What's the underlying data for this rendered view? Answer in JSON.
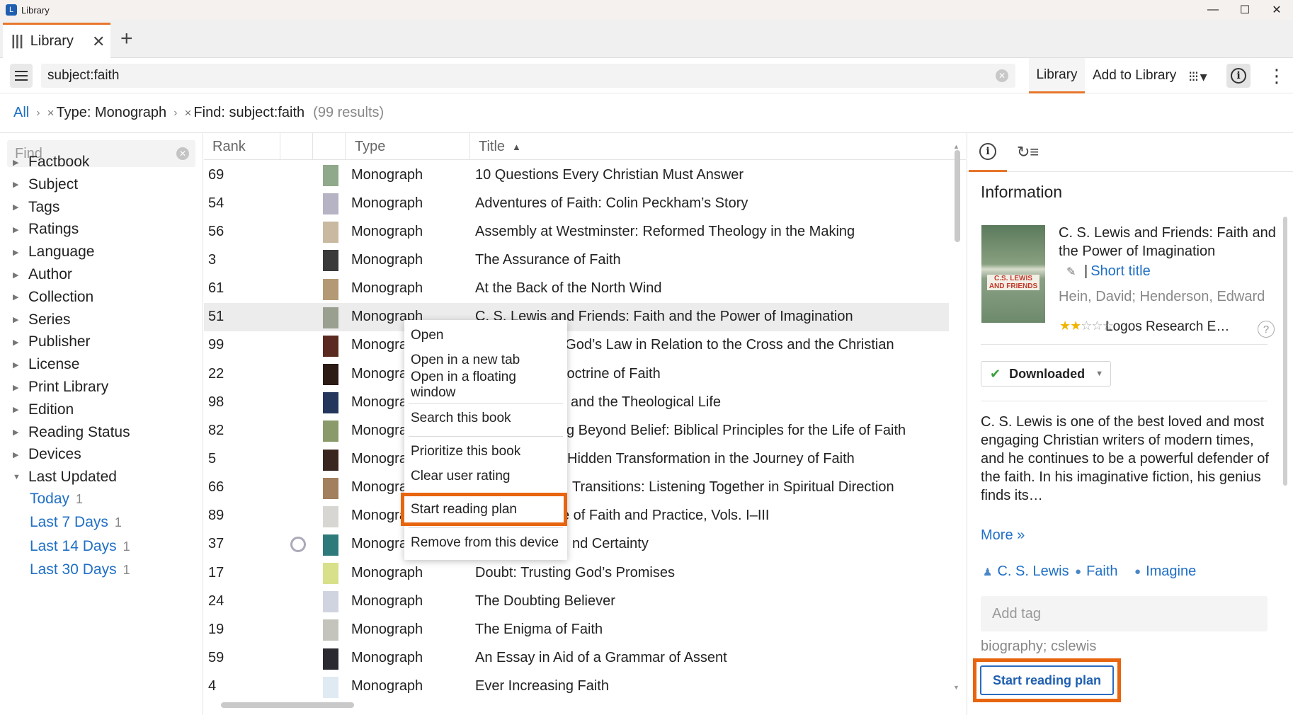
{
  "window": {
    "title": "Library"
  },
  "tabs": {
    "active_label": "Library"
  },
  "toolbar": {
    "search_value": "subject:faith",
    "tab_library": "Library",
    "tab_add": "Add to Library"
  },
  "breadcrumb": {
    "all": "All",
    "crumb1": "Type: Monograph",
    "crumb2": "Find: subject:faith",
    "count": "(99 results)"
  },
  "sidebar": {
    "find_placeholder": "Find",
    "facets": [
      "Factbook",
      "Subject",
      "Tags",
      "Ratings",
      "Language",
      "Author",
      "Collection",
      "Series",
      "Publisher",
      "License",
      "Print Library",
      "Edition",
      "Reading Status",
      "Devices",
      "Last Updated"
    ],
    "last_updated": [
      {
        "label": "Today",
        "count": "1"
      },
      {
        "label": "Last 7 Days",
        "count": "1"
      },
      {
        "label": "Last 14 Days",
        "count": "1"
      },
      {
        "label": "Last 30 Days",
        "count": "1"
      }
    ]
  },
  "table": {
    "headers": {
      "rank": "Rank",
      "type": "Type",
      "title": "Title"
    },
    "rows": [
      {
        "rank": "69",
        "type": "Monograph",
        "title": "10 Questions Every Christian Must Answer"
      },
      {
        "rank": "54",
        "type": "Monograph",
        "title": "Adventures of Faith: Colin Peckham’s Story"
      },
      {
        "rank": "56",
        "type": "Monograph",
        "title": "Assembly at Westminster: Reformed Theology in the Making"
      },
      {
        "rank": "3",
        "type": "Monograph",
        "title": "The Assurance of Faith"
      },
      {
        "rank": "61",
        "type": "Monograph",
        "title": "At the Back of the North Wind"
      },
      {
        "rank": "51",
        "type": "Monograph",
        "title": "C. S. Lewis and Friends: Faith and the Power of Imagination"
      },
      {
        "rank": "99",
        "type": "Monograph",
        "title": "d: God’s Law in Relation to the Cross and the Christian"
      },
      {
        "rank": "22",
        "type": "Monograph",
        "title": "Doctrine of Faith"
      },
      {
        "rank": "98",
        "type": "Monograph",
        "title": "and the Theological Life"
      },
      {
        "rank": "82",
        "type": "Monograph",
        "title": "g Beyond Belief: Biblical Principles for the Life of Faith"
      },
      {
        "rank": "5",
        "type": "Monograph",
        "title": "Hidden Transformation in the Journey of Faith"
      },
      {
        "rank": "66",
        "type": "Monograph",
        "title": "Transitions: Listening Together in Spiritual Direction"
      },
      {
        "rank": "89",
        "type": "Monograph",
        "title": "e of Faith and Practice, Vols. I–III"
      },
      {
        "rank": "37",
        "type": "Monograph",
        "title": "nd Certainty"
      },
      {
        "rank": "17",
        "type": "Monograph",
        "title": "Doubt: Trusting God’s Promises"
      },
      {
        "rank": "24",
        "type": "Monograph",
        "title": "The Doubting Believer"
      },
      {
        "rank": "19",
        "type": "Monograph",
        "title": "The Enigma of Faith"
      },
      {
        "rank": "59",
        "type": "Monograph",
        "title": "An Essay in Aid of a Grammar of Assent"
      },
      {
        "rank": "4",
        "type": "Monograph",
        "title": "Ever Increasing Faith"
      }
    ]
  },
  "context_menu": {
    "open": "Open",
    "open_tab": "Open in a new tab",
    "open_float": "Open in a floating window",
    "search_book": "Search this book",
    "prioritize": "Prioritize this book",
    "clear_rating": "Clear user rating",
    "reading_plan": "Start reading plan",
    "remove": "Remove from this device"
  },
  "info": {
    "heading": "Information",
    "title": "C. S. Lewis and Friends: Faith and the Power of Imagination",
    "short_title": "Short title",
    "authors": "Hein, David; Henderson, Edward",
    "publisher": "Logos Research E…",
    "rating": 2,
    "status": "Downloaded",
    "description": "C. S. Lewis is one of the best loved and most engaging Christian writers of modern times, and he continues to be a powerful defender of the faith. In his imaginative fiction, his genius finds its…",
    "more": "More »",
    "topics": [
      "C. S. Lewis",
      "Faith",
      "Imagine"
    ],
    "add_tag_placeholder": "Add tag",
    "tags": "biography; cslewis",
    "reading_plan_button": "Start reading plan",
    "cover_text": "C.S. LEWIS AND FRIENDS"
  },
  "colors": {
    "accent": "#e8762c",
    "link": "#1f6fc5",
    "highlight": "#e8650f"
  }
}
